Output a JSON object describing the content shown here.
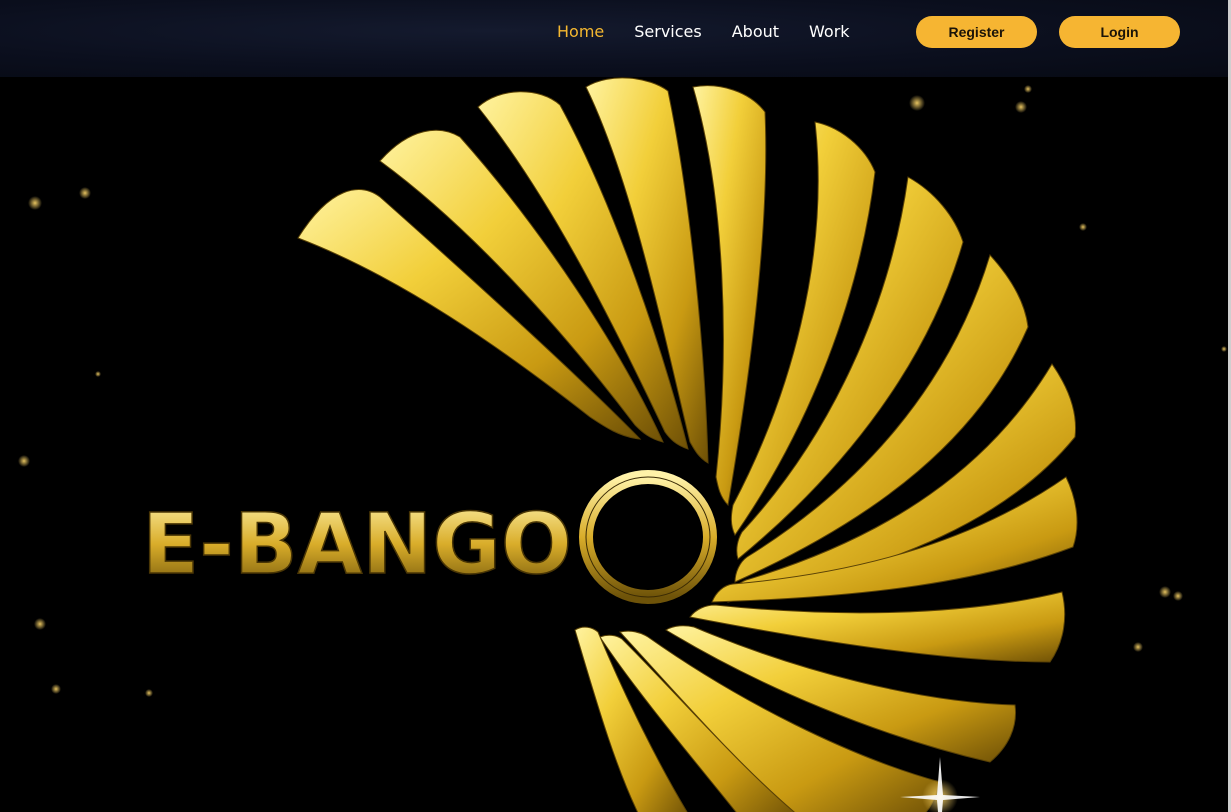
{
  "nav": {
    "items": [
      {
        "label": "Home",
        "active": true
      },
      {
        "label": "Services",
        "active": false
      },
      {
        "label": "About",
        "active": false
      },
      {
        "label": "Work",
        "active": false
      }
    ]
  },
  "actions": {
    "register_label": "Register",
    "login_label": "Login"
  },
  "hero": {
    "logo_text": "E-BANGO"
  },
  "colors": {
    "accent": "#f6b532",
    "active_nav": "#f5b830",
    "header_bg": "#0b0f1e",
    "gold_light": "#f6e27a",
    "gold_mid": "#d6a51c",
    "gold_dark": "#7a5a08"
  }
}
